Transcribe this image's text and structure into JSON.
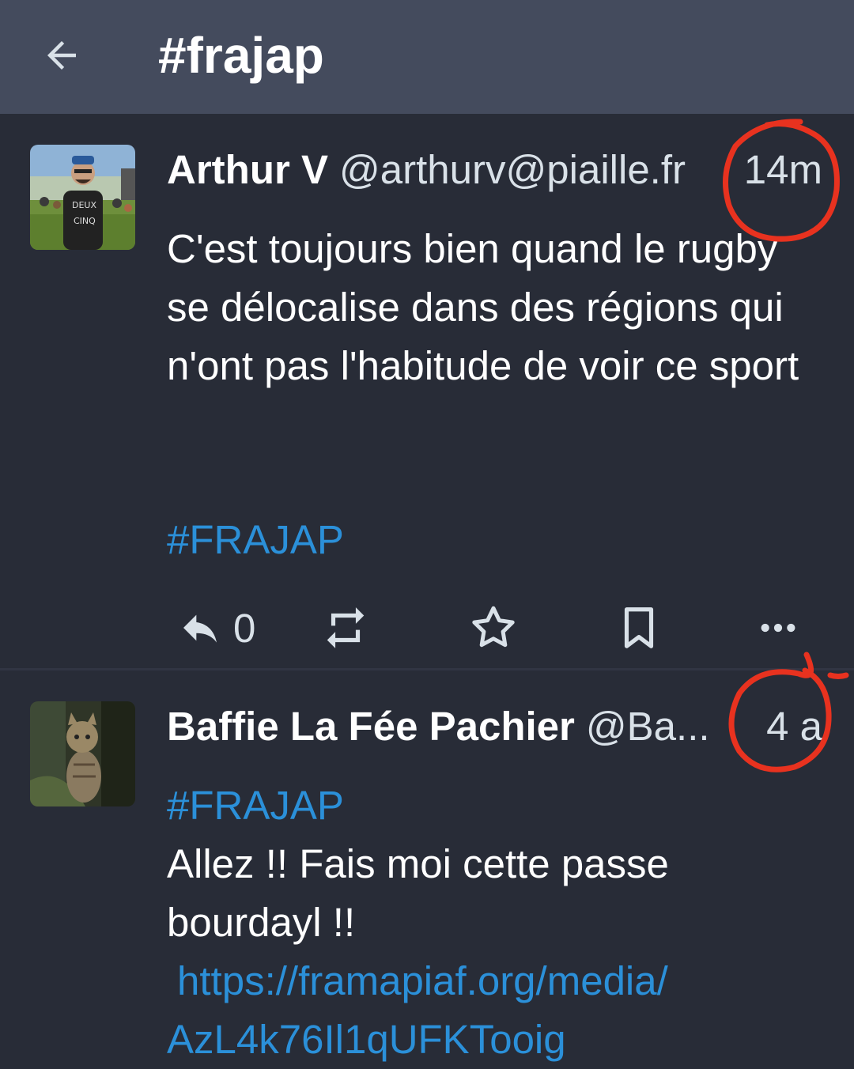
{
  "appbar": {
    "back_icon": "arrow-left-icon",
    "title": "#frajap"
  },
  "statuses": [
    {
      "display_name": "Arthur V",
      "acct": "@arthurv@piaille.fr",
      "time": "14m",
      "paragraphs": [
        "C'est toujours bien quand le rugby se délocalise dans des régions qui n'ont pas l'habitude de voir ce sport"
      ],
      "hashtag": "#FRAJAP",
      "actions": {
        "reply_icon": "reply-icon",
        "reply_count": "0",
        "boost_icon": "boost-icon",
        "favourite_icon": "star-icon",
        "bookmark_icon": "bookmark-icon",
        "more_icon": "more-horizontal-icon"
      }
    },
    {
      "display_name": "Baffie La Fée Pachier",
      "acct": "@Ba...",
      "time": "4 a",
      "hashtag": "#FRAJAP",
      "text": "Allez !! Fais moi cette passe bourdayl !!",
      "link_line1": "https://framapiaf.org/media/",
      "link_line2": "AzL4k76Il1qUFKTooig"
    }
  ],
  "colors": {
    "background": "#282c37",
    "appbar": "#444b5d",
    "hashtag": "#2b90d9",
    "annotation": "#e8321f"
  }
}
